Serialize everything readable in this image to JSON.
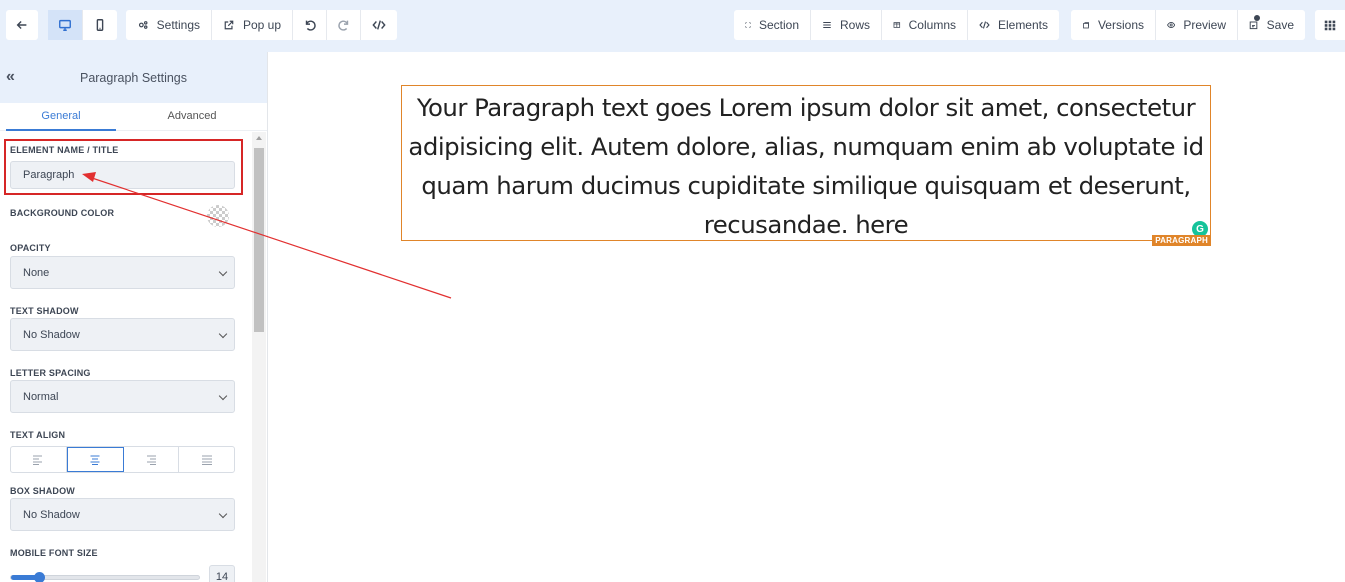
{
  "toolbar": {
    "back_icon": "arrow-left-icon",
    "desktop_icon": "desktop-icon",
    "mobile_icon": "mobile-icon",
    "settings_label": "Settings",
    "popup_label": "Pop up",
    "section_label": "Section",
    "rows_label": "Rows",
    "columns_label": "Columns",
    "elements_label": "Elements",
    "versions_label": "Versions",
    "preview_label": "Preview",
    "save_label": "Save"
  },
  "sidebar": {
    "title": "Paragraph Settings",
    "tabs": [
      {
        "label": "General",
        "active": true
      },
      {
        "label": "Advanced",
        "active": false
      }
    ],
    "fields": {
      "element_name_label": "ELEMENT NAME / TITLE",
      "element_name_value": "Paragraph",
      "background_color_label": "BACKGROUND COLOR",
      "opacity_label": "OPACITY",
      "opacity_value": "None",
      "text_shadow_label": "TEXT SHADOW",
      "text_shadow_value": "No Shadow",
      "letter_spacing_label": "LETTER SPACING",
      "letter_spacing_value": "Normal",
      "text_align_label": "TEXT ALIGN",
      "text_align_selected": "center",
      "box_shadow_label": "BOX SHADOW",
      "box_shadow_value": "No Shadow",
      "mobile_font_size_label": "MOBILE FONT SIZE",
      "mobile_font_size_value": "14",
      "mobile_font_size_fraction": 0.15
    }
  },
  "canvas": {
    "paragraph_text": "Your Paragraph text goes Lorem ipsum dolor sit amet, consectetur adipisicing elit. Autem dolore, alias, numquam enim ab voluptate id quam harum ducimus cupiditate similique quisquam et deserunt, recusandae. here",
    "badge": "PARAGRAPH",
    "grammarly_letter": "G"
  },
  "colors": {
    "accent": "#3a7bd5",
    "highlight_border": "#d62626",
    "element_outline": "#e0852a",
    "toolbar_bg": "#e8f0fb"
  }
}
